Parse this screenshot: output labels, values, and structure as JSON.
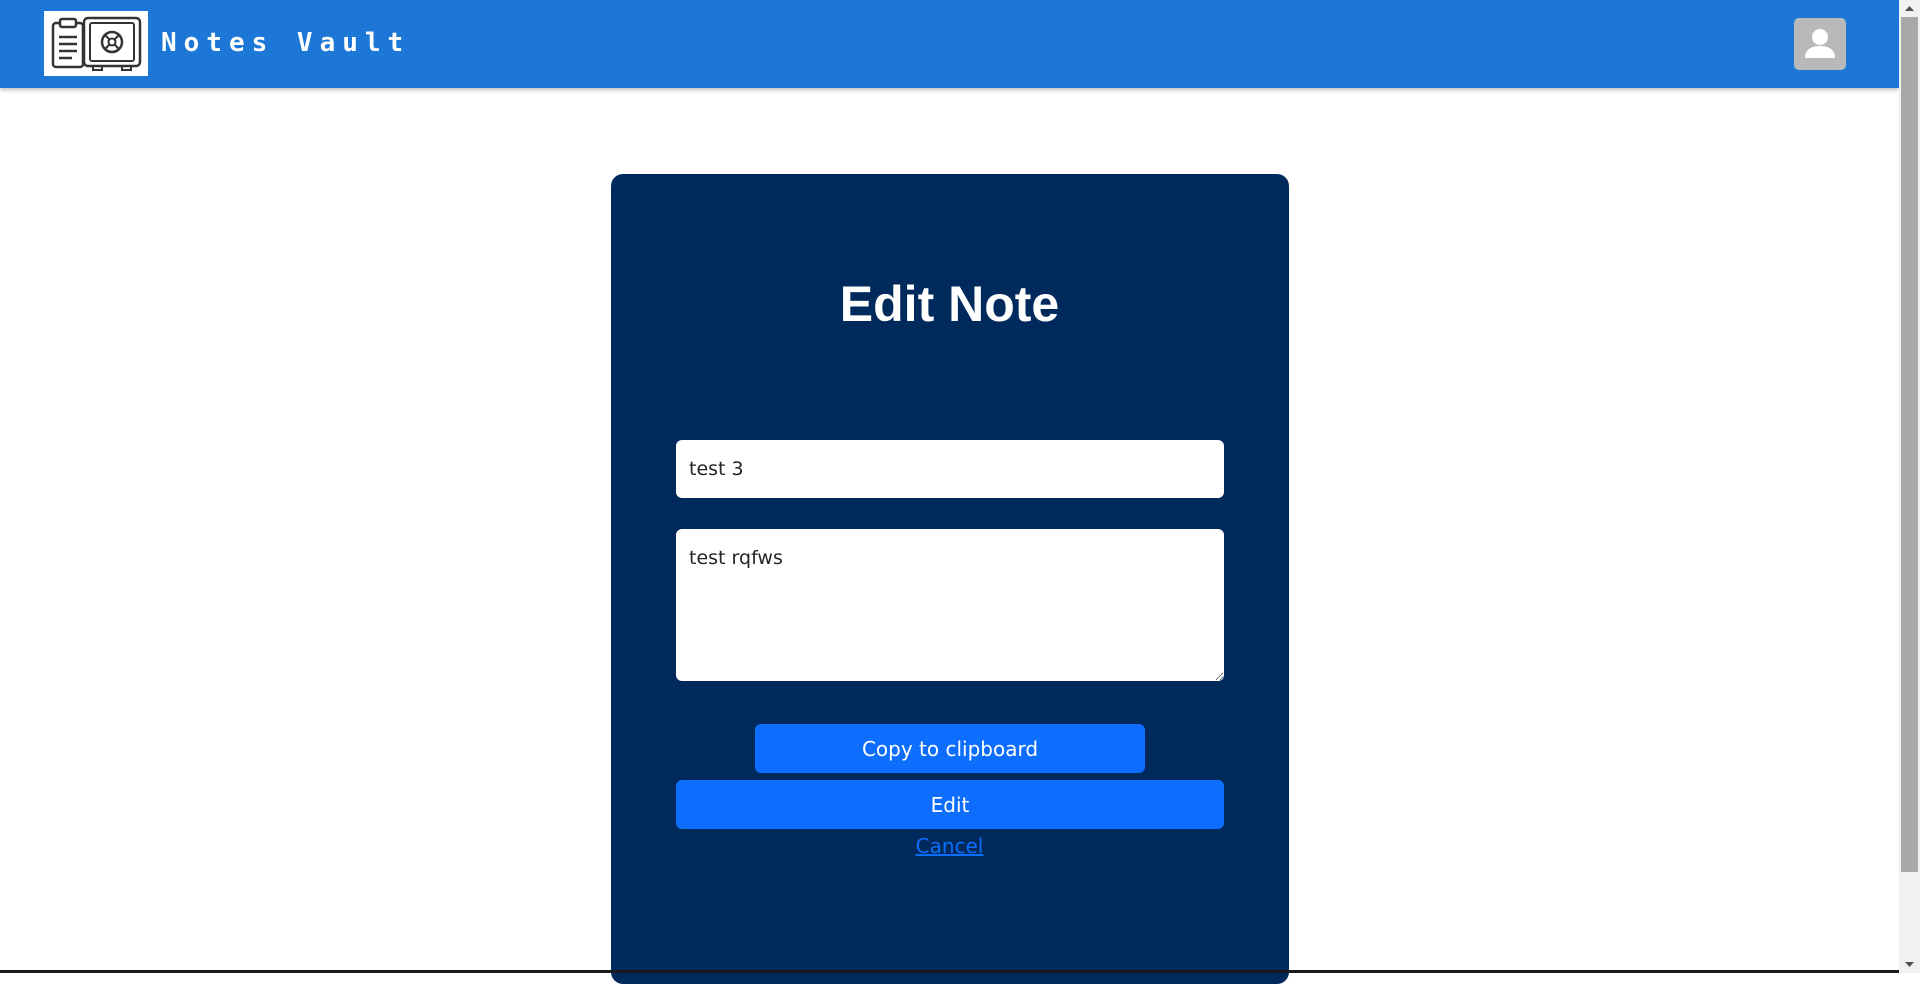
{
  "app": {
    "brand_name": "Notes Vault",
    "logo_icon": "clipboard-safe-logo",
    "profile_icon": "user-avatar-icon",
    "nav_color": "#1c77d6"
  },
  "form": {
    "heading": "Edit Note",
    "title_value": "test 3",
    "body_value": "test rqfws",
    "card_color": "#00295c"
  },
  "actions": {
    "copy_label": "Copy to clipboard",
    "edit_label": "Edit",
    "cancel_label": "Cancel",
    "accent_color": "#0d6efd"
  }
}
